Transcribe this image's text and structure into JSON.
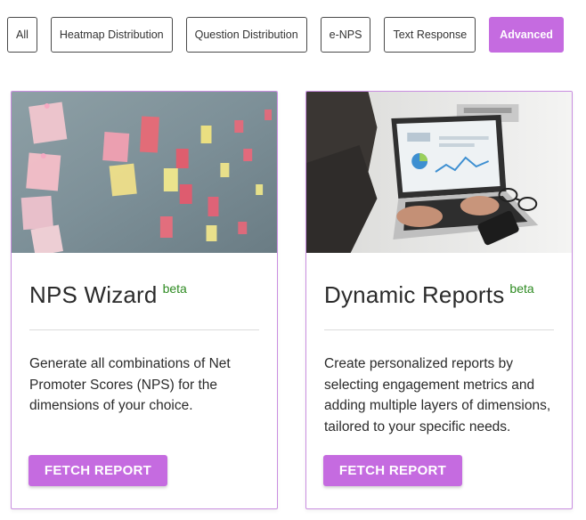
{
  "filters": [
    {
      "label": "All",
      "active": false
    },
    {
      "label": "Heatmap Distribution",
      "active": false
    },
    {
      "label": "Question Distribution",
      "active": false
    },
    {
      "label": "e-NPS",
      "active": false
    },
    {
      "label": "Text Response",
      "active": false
    },
    {
      "label": "Advanced",
      "active": true
    }
  ],
  "accent_color": "#c56be0",
  "cards": [
    {
      "title": "NPS Wizard",
      "badge": "beta",
      "description": "Generate all combinations of Net Promoter Scores (NPS) for the dimensions of your choice.",
      "button_label": "FETCH REPORT",
      "image": "sticky-notes-photo"
    },
    {
      "title": "Dynamic Reports",
      "badge": "beta",
      "description": "Create personalized reports by selecting engagement metrics and adding multiple layers of dimensions, tailored to your specific needs.",
      "button_label": "FETCH REPORT",
      "image": "laptop-dashboard-photo"
    }
  ]
}
